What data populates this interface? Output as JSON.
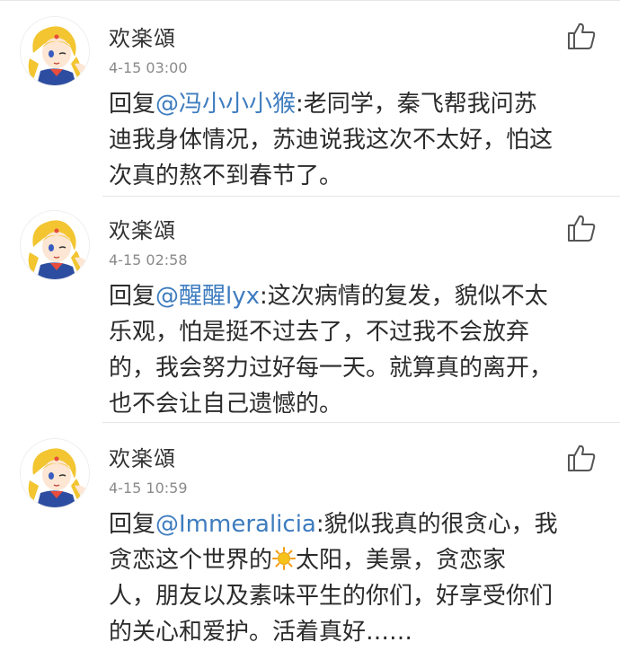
{
  "comments": [
    {
      "username": "欢楽頌",
      "time": "4-15 03:00",
      "reply_prefix": "回复",
      "mention": "@冯小小小猴",
      "lines": [
        ":老同学，秦飞帮我问苏",
        "迪我身体情况，苏迪说我这次不太好，怕这",
        "次真的熬不到春节了。"
      ]
    },
    {
      "username": "欢楽頌",
      "time": "4-15 02:58",
      "reply_prefix": "回复",
      "mention": "@醒醒lyx",
      "lines": [
        ":这次病情的复发，貌似不太",
        "乐观，怕是挺不过去了，不过我不会放弃",
        "的，我会努力过好每一天。就算真的离开，",
        "也不会让自己遗憾的。"
      ]
    },
    {
      "username": "欢楽頌",
      "time": "4-15 10:59",
      "reply_prefix": "回复",
      "mention": "@Immeralicia",
      "lines": [
        ":貌似我真的很贪心，我",
        "贪恋这个世界的",
        "太阳，美景，贪恋家",
        "人，朋友以及素味平生的你们，好享受你们",
        "的关心和爱护。活着真好……"
      ]
    }
  ],
  "icons": {
    "avatar": "sailor-moon-avatar",
    "like": "thumbs-up-icon",
    "emoji": "sun-emoji-icon"
  },
  "colors": {
    "mention": "#3e7cbf",
    "time": "#8a8a8a",
    "divider": "#e6e6e6"
  }
}
